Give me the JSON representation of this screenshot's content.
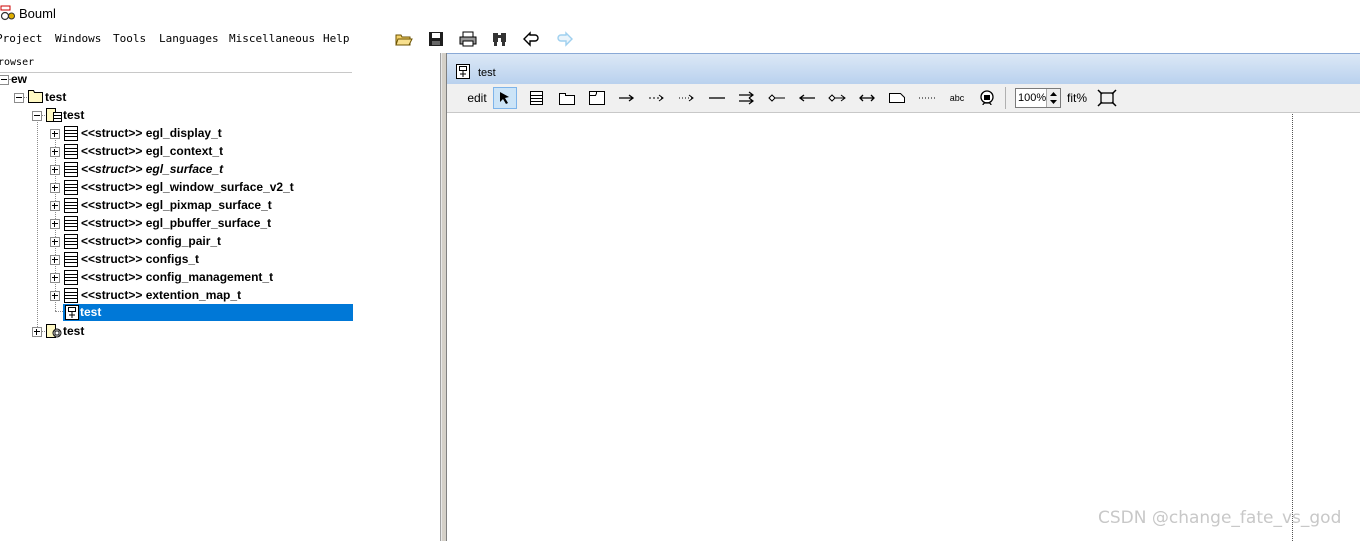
{
  "app": {
    "title": "Bouml"
  },
  "menu": {
    "items": [
      "Project",
      "Windows",
      "Tools",
      "Languages",
      "Miscellaneous",
      "Help"
    ],
    "toolbar_icons": [
      "open-folder-icon",
      "save-icon",
      "print-icon",
      "find-icon",
      "back-arrow-icon",
      "forward-arrow-icon"
    ]
  },
  "browser": {
    "header": "rowser",
    "tree": [
      {
        "label": "ew"
      },
      {
        "label": "test"
      },
      {
        "label": "test"
      },
      {
        "label": "<<struct>> egl_display_t"
      },
      {
        "label": "<<struct>> egl_context_t"
      },
      {
        "label": "<<struct>> egl_surface_t"
      },
      {
        "label": "<<struct>> egl_window_surface_v2_t"
      },
      {
        "label": "<<struct>> egl_pixmap_surface_t"
      },
      {
        "label": "<<struct>> egl_pbuffer_surface_t"
      },
      {
        "label": "<<struct>> config_pair_t"
      },
      {
        "label": "<<struct>> configs_t"
      },
      {
        "label": "<<struct>> config_management_t"
      },
      {
        "label": "<<struct>> extention_map_t"
      },
      {
        "label": "test",
        "selected": true
      },
      {
        "label": "test"
      }
    ]
  },
  "diagram": {
    "title": "test",
    "toolbar": {
      "edit_label": "edit",
      "abc_label": "abc",
      "zoom_value": "100%",
      "fit_label": "fit%"
    }
  },
  "watermark": "CSDN @change_fate_vs_god",
  "colors": {
    "selection": "#0078d7",
    "titlebar_gradient_top": "#dce8f6",
    "titlebar_gradient_bottom": "#b9d1ee"
  }
}
